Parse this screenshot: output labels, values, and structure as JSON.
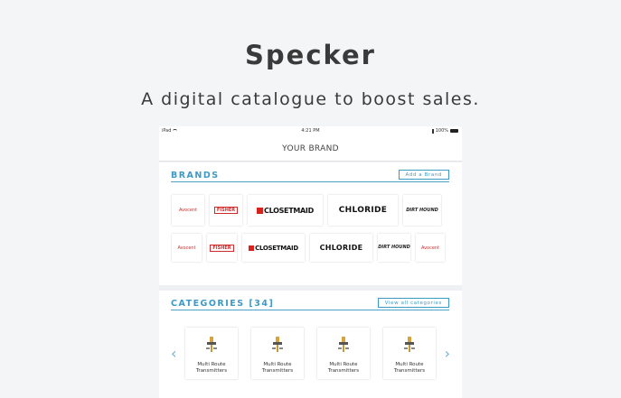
{
  "hero": {
    "title": "Specker",
    "tagline": "A digital catalogue to boost sales."
  },
  "statusbar": {
    "device": "iPad",
    "time": "4:21 PM",
    "battery": "100%"
  },
  "navbar": {
    "title": "YOUR BRAND"
  },
  "brands": {
    "title": "BRANDS",
    "button_label": "Add a Brand",
    "row1": [
      {
        "name": "Avocent",
        "style": "avocent"
      },
      {
        "name": "FISHER",
        "style": "fisher"
      },
      {
        "name": "CLOSETMAID",
        "style": "closetmaid"
      },
      {
        "name": "CHLORIDE",
        "style": "chloride"
      },
      {
        "name": "DIRT HOUND",
        "style": "dirthound"
      }
    ],
    "row2": [
      {
        "name": "Avocent",
        "style": "avocent"
      },
      {
        "name": "FISHER",
        "style": "fisher"
      },
      {
        "name": "CLOSETMAID",
        "style": "closetmaid"
      },
      {
        "name": "CHLORIDE",
        "style": "chloride"
      },
      {
        "name": "DIRT HOUND",
        "style": "dirthound"
      },
      {
        "name": "Avocent",
        "style": "avocent"
      }
    ],
    "pages": 5,
    "active_page": 1
  },
  "categories": {
    "title": "CATEGORIES [34]",
    "button_label": "View all categories",
    "items": [
      {
        "line1": "Multi Route",
        "line2": "Transmitters"
      },
      {
        "line1": "Multi Route",
        "line2": "Transmitters"
      },
      {
        "line1": "Multi Route",
        "line2": "Transmitters"
      },
      {
        "line1": "Multi Route",
        "line2": "Transmitters"
      }
    ],
    "prev_icon": "chevron-left-icon",
    "next_icon": "chevron-right-icon"
  },
  "colors": {
    "accent": "#3d9ac4",
    "background": "#f4f5f7",
    "closetmaid_red": "#d6211c"
  }
}
